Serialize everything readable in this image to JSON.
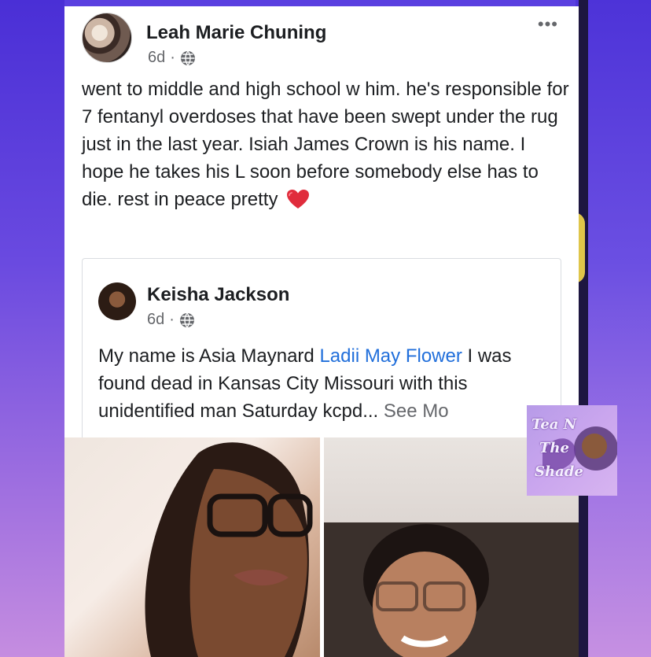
{
  "post": {
    "author": "Leah Marie Chuning",
    "time": "6d",
    "separator": "·",
    "more": "•••",
    "text": "went to middle and high school w him. he's responsible for 7 fentanyl overdoses that have been swept under the rug just in the last year. Isiah James Crown is his name. I hope he takes his L soon before somebody else has to die. rest in peace pretty"
  },
  "shared": {
    "author": "Keisha Jackson",
    "time": "6d",
    "separator": "·",
    "text_before": "My name is Asia Maynard ",
    "link": "Ladii May Flower",
    "text_after": " I was found dead in Kansas City Missouri with this unidentified man Saturday kcpd... ",
    "see_more": "See Mo"
  },
  "watermark": {
    "line1": "Tea N",
    "line2": "The",
    "line3": "Shade"
  },
  "colors": {
    "link": "#216fdb",
    "heart": "#e02c3c",
    "background": "#6f55e8"
  },
  "icons": [
    "globe-icon",
    "heart-icon",
    "more-icon"
  ]
}
